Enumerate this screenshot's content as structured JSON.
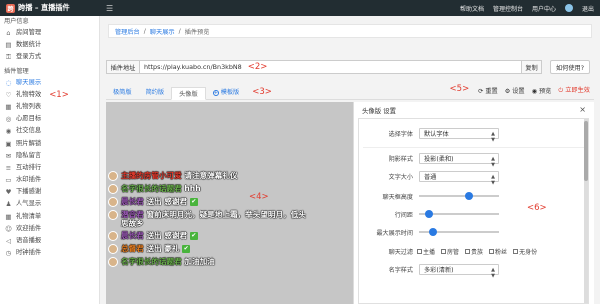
{
  "topbar": {
    "app_title": "跨播 – 直播插件",
    "logo_char": "跨",
    "menu_toggle": "☰",
    "links": [
      "帮助文档",
      "管理控制台",
      "用户中心"
    ],
    "logout": "退出"
  },
  "sidebar": {
    "group1": "用户信息",
    "group1_items": [
      {
        "label": "房间管理",
        "icon": "home-icon",
        "glyph": "⌂"
      },
      {
        "label": "数据统计",
        "icon": "chart-icon",
        "glyph": "▤"
      },
      {
        "label": "登录方式",
        "icon": "key-icon",
        "glyph": "⚿"
      }
    ],
    "group2": "插件管理",
    "group2_items": [
      {
        "label": "聊天展示",
        "icon": "chat-icon",
        "glyph": "◌",
        "active": true
      },
      {
        "label": "礼物特效",
        "icon": "gift-icon",
        "glyph": "♡",
        "annotation": "<1>"
      },
      {
        "label": "礼物列表",
        "icon": "list-icon",
        "glyph": "▦"
      },
      {
        "label": "心愿目标",
        "icon": "target-icon",
        "glyph": "◎"
      },
      {
        "label": "社交信息",
        "icon": "social-icon",
        "glyph": "◉"
      },
      {
        "label": "照片解锁",
        "icon": "photo-icon",
        "glyph": "▣"
      },
      {
        "label": "隐私留言",
        "icon": "message-icon",
        "glyph": "✉"
      },
      {
        "label": "互动排行",
        "icon": "rank-icon",
        "glyph": "≡"
      },
      {
        "label": "水印插件",
        "icon": "watermark-icon",
        "glyph": "▭"
      },
      {
        "label": "下播感谢",
        "icon": "thanks-icon",
        "glyph": "♥"
      },
      {
        "label": "人气显示",
        "icon": "popularity-icon",
        "glyph": "♟"
      },
      {
        "label": "礼物清单",
        "icon": "gift-list-icon",
        "glyph": "▦"
      },
      {
        "label": "欢迎插件",
        "icon": "welcome-icon",
        "glyph": "☺"
      },
      {
        "label": "语音播报",
        "icon": "speaker-icon",
        "glyph": "◁"
      },
      {
        "label": "时钟插件",
        "icon": "clock-icon",
        "glyph": "◷"
      }
    ]
  },
  "breadcrumb": {
    "items": [
      "管理后台",
      "聊天展示",
      "插件预览"
    ],
    "sep": "/"
  },
  "url_row": {
    "label": "插件地址",
    "value": "https://play.kuabo.cn/Bn3kbN8",
    "annotation": "<2>",
    "copy": "复制",
    "help": "如何使用?"
  },
  "tabs": {
    "items": [
      "极简版",
      "简约版",
      "头像版",
      "模板版"
    ],
    "annotation": "<3>",
    "tools_annotation": "<5>",
    "tools": [
      "重置",
      "设置",
      "预览",
      "立即生效"
    ]
  },
  "chat": {
    "annotation": "<4>",
    "messages": [
      {
        "name": "主播的房管小可爱",
        "name_color": "#e23b2e",
        "text": "请注意弹幕礼仪",
        "ok": false
      },
      {
        "name": "名字很长的话题君",
        "name_color": "#6ab04c",
        "text": "hhh",
        "ok": false
      },
      {
        "name": "晨长君",
        "name_color": "#9b59b6",
        "text": "送出 感谢君",
        "ok": true
      },
      {
        "name": "潜音君",
        "name_color": "#9b59b6",
        "text": "窗前床明月光，疑是地上霜，举头望明月，低头思故乡",
        "ok": false
      },
      {
        "name": "晨长君",
        "name_color": "#9b59b6",
        "text": "送出 感谢君",
        "ok": true
      },
      {
        "name": "总督君",
        "name_color": "#e67e22",
        "text": "送出 豪礼",
        "ok": true
      },
      {
        "name": "名字很长的话题君",
        "name_color": "#6ab04c",
        "text": "加油加油",
        "ok": false
      }
    ],
    "check_glyph": "✔"
  },
  "panel": {
    "title": "头像版 设置",
    "close": "×",
    "annotation": "<6>",
    "font_label": "选择字体",
    "font_value": "默认字体",
    "effect_label": "阴影样式",
    "effect_value": "投影(柔和)",
    "size_label": "文字大小",
    "size_value": "普通",
    "height_label": "聊天框高度",
    "height_level": 0.62,
    "spacing_label": "行间距",
    "spacing_level": 0.12,
    "time_label": "最大展示时间",
    "time_level": 0.18,
    "filter_label": "聊天过滤",
    "filters": [
      "主播",
      "房管",
      "贵族",
      "粉丝",
      "无身份"
    ],
    "name_style_label": "名字样式",
    "name_style_value": "多彩(清新)"
  }
}
